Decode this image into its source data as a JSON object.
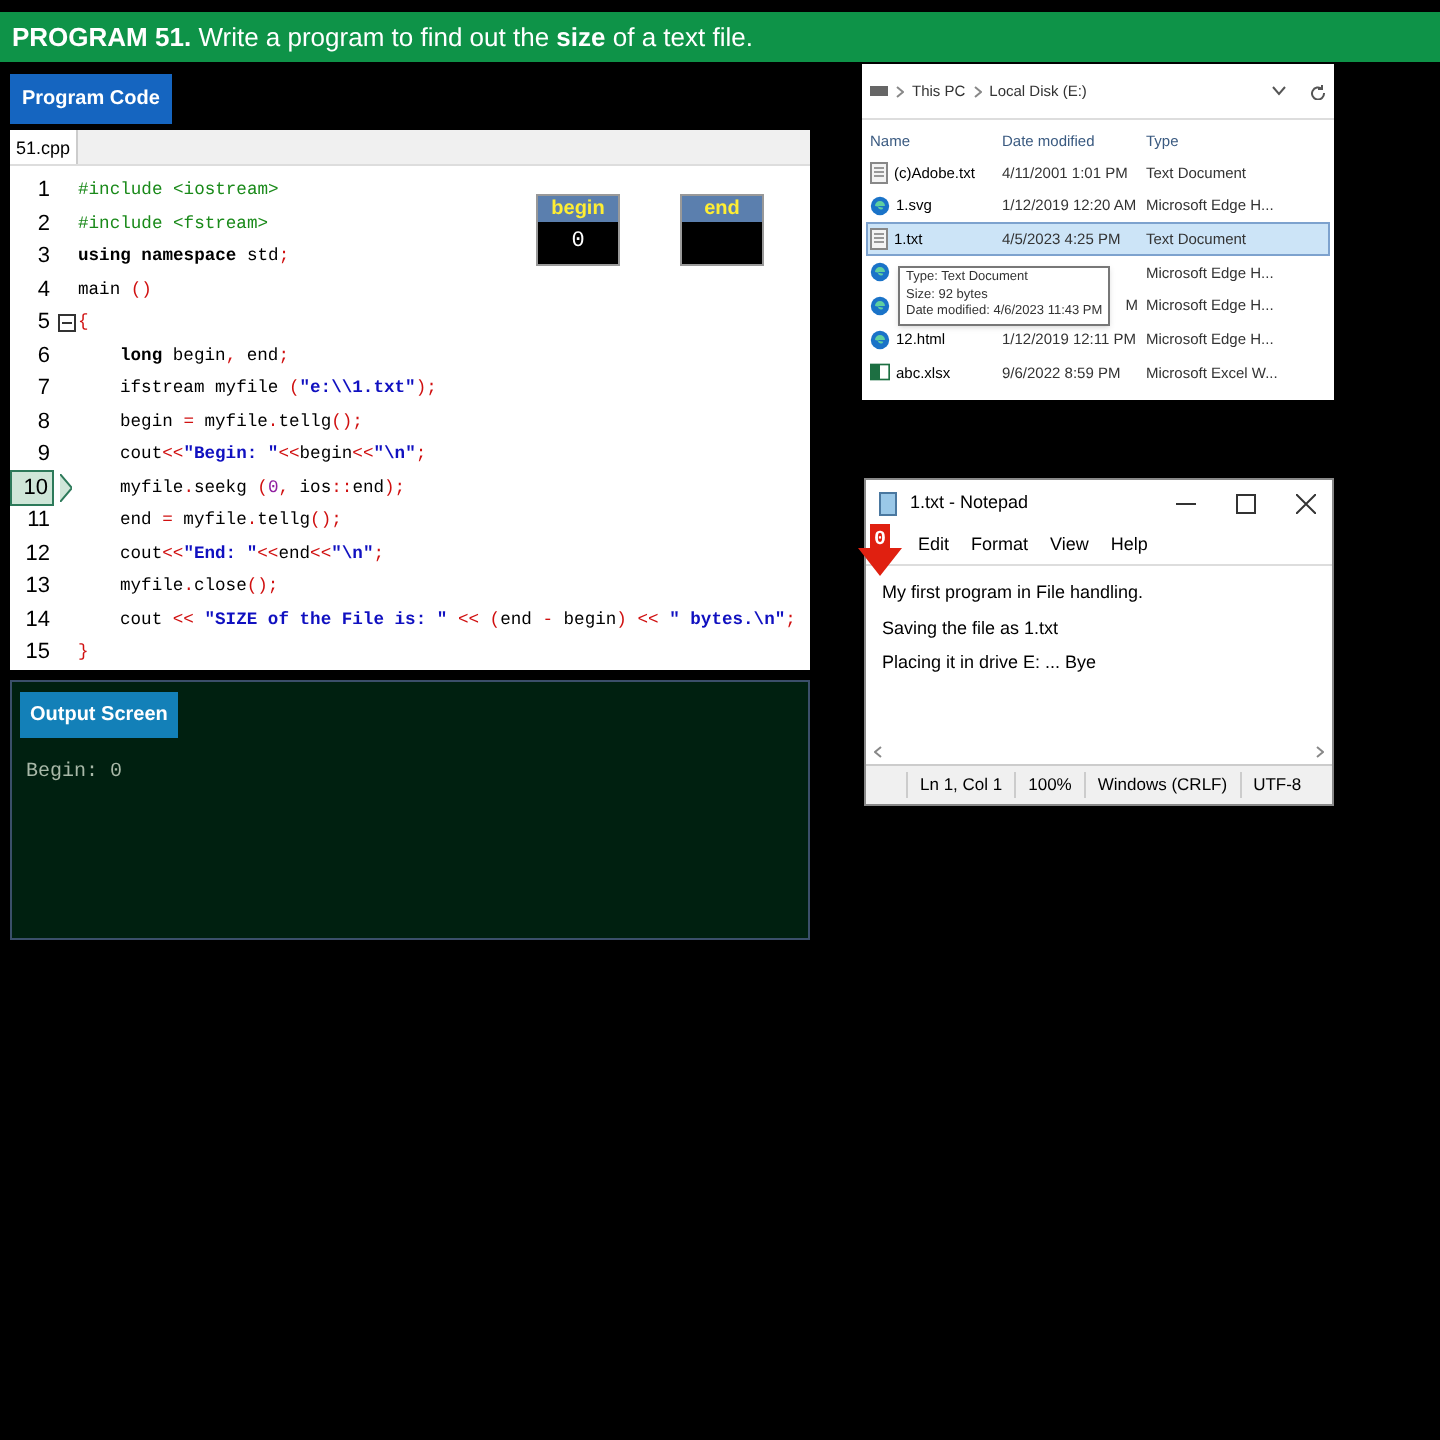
{
  "header": {
    "title_bold": "PROGRAM 51.",
    "title_rest": "Write a program to find out the **size** of a text file."
  },
  "code_label": "Program Code",
  "editor": {
    "tab": "51.cpp",
    "lines": [
      {
        "no": "1",
        "indent": false,
        "current": false,
        "foldable": false,
        "tokens": [
          {
            "kind": "pre",
            "text": "#include <iostream>"
          }
        ]
      },
      {
        "no": "2",
        "indent": false,
        "current": false,
        "foldable": false,
        "tokens": [
          {
            "kind": "pre",
            "text": "#include <fstream>"
          }
        ]
      },
      {
        "no": "3",
        "indent": false,
        "current": false,
        "foldable": false,
        "tokens": [
          {
            "kind": "kw",
            "text": "using namespace"
          },
          {
            "kind": "plain",
            "text": " std"
          },
          {
            "kind": "punct",
            "text": ";"
          }
        ]
      },
      {
        "no": "4",
        "indent": false,
        "current": false,
        "foldable": false,
        "tokens": [
          {
            "kind": "plain",
            "text": "main "
          },
          {
            "kind": "punct",
            "text": "()"
          }
        ]
      },
      {
        "no": "5",
        "indent": false,
        "current": false,
        "foldable": true,
        "tokens": [
          {
            "kind": "punct",
            "text": "{"
          }
        ]
      },
      {
        "no": "6",
        "indent": true,
        "current": false,
        "foldable": false,
        "tokens": [
          {
            "kind": "kw",
            "text": "long"
          },
          {
            "kind": "plain",
            "text": " begin"
          },
          {
            "kind": "punct",
            "text": ","
          },
          {
            "kind": "plain",
            "text": " end"
          },
          {
            "kind": "punct",
            "text": ";"
          }
        ]
      },
      {
        "no": "7",
        "indent": true,
        "current": false,
        "foldable": false,
        "tokens": [
          {
            "kind": "plain",
            "text": "ifstream myfile "
          },
          {
            "kind": "punct",
            "text": "("
          },
          {
            "kind": "str",
            "text": "\"e:\\\\1.txt\""
          },
          {
            "kind": "punct",
            "text": ");"
          }
        ]
      },
      {
        "no": "8",
        "indent": true,
        "current": false,
        "foldable": false,
        "tokens": [
          {
            "kind": "plain",
            "text": "begin "
          },
          {
            "kind": "punct",
            "text": "="
          },
          {
            "kind": "plain",
            "text": " myfile"
          },
          {
            "kind": "punct",
            "text": "."
          },
          {
            "kind": "plain",
            "text": "tellg"
          },
          {
            "kind": "punct",
            "text": "();"
          }
        ]
      },
      {
        "no": "9",
        "indent": true,
        "current": false,
        "foldable": false,
        "tokens": [
          {
            "kind": "plain",
            "text": "cout"
          },
          {
            "kind": "punct",
            "text": "<<"
          },
          {
            "kind": "str",
            "text": "\"Begin: \""
          },
          {
            "kind": "punct",
            "text": "<<"
          },
          {
            "kind": "plain",
            "text": "begin"
          },
          {
            "kind": "punct",
            "text": "<<"
          },
          {
            "kind": "str",
            "text": "\"\\n\""
          },
          {
            "kind": "punct",
            "text": ";"
          }
        ]
      },
      {
        "no": "10",
        "indent": true,
        "current": true,
        "foldable": false,
        "tokens": [
          {
            "kind": "plain",
            "text": "myfile"
          },
          {
            "kind": "punct",
            "text": "."
          },
          {
            "kind": "plain",
            "text": "seekg "
          },
          {
            "kind": "punct",
            "text": "("
          },
          {
            "kind": "num",
            "text": "0"
          },
          {
            "kind": "punct",
            "text": ","
          },
          {
            "kind": "plain",
            "text": " ios"
          },
          {
            "kind": "punct",
            "text": "::"
          },
          {
            "kind": "plain",
            "text": "end"
          },
          {
            "kind": "punct",
            "text": ");"
          }
        ]
      },
      {
        "no": "11",
        "indent": true,
        "current": false,
        "foldable": false,
        "tokens": [
          {
            "kind": "plain",
            "text": "end "
          },
          {
            "kind": "punct",
            "text": "="
          },
          {
            "kind": "plain",
            "text": " myfile"
          },
          {
            "kind": "punct",
            "text": "."
          },
          {
            "kind": "plain",
            "text": "tellg"
          },
          {
            "kind": "punct",
            "text": "();"
          }
        ]
      },
      {
        "no": "12",
        "indent": true,
        "current": false,
        "foldable": false,
        "tokens": [
          {
            "kind": "plain",
            "text": "cout"
          },
          {
            "kind": "punct",
            "text": "<<"
          },
          {
            "kind": "str",
            "text": "\"End: \""
          },
          {
            "kind": "punct",
            "text": "<<"
          },
          {
            "kind": "plain",
            "text": "end"
          },
          {
            "kind": "punct",
            "text": "<<"
          },
          {
            "kind": "str",
            "text": "\"\\n\""
          },
          {
            "kind": "punct",
            "text": ";"
          }
        ]
      },
      {
        "no": "13",
        "indent": true,
        "current": false,
        "foldable": false,
        "tokens": [
          {
            "kind": "plain",
            "text": "myfile"
          },
          {
            "kind": "punct",
            "text": "."
          },
          {
            "kind": "plain",
            "text": "close"
          },
          {
            "kind": "punct",
            "text": "();"
          }
        ]
      },
      {
        "no": "14",
        "indent": true,
        "current": false,
        "foldable": false,
        "tokens": [
          {
            "kind": "plain",
            "text": "cout "
          },
          {
            "kind": "punct",
            "text": "<<"
          },
          {
            "kind": "str",
            "text": " \"SIZE of the File is: \" "
          },
          {
            "kind": "punct",
            "text": "<< ("
          },
          {
            "kind": "plain",
            "text": "end "
          },
          {
            "kind": "punct",
            "text": "-"
          },
          {
            "kind": "plain",
            "text": " begin"
          },
          {
            "kind": "punct",
            "text": ") <<"
          },
          {
            "kind": "str",
            "text": " \" bytes.\\n\""
          },
          {
            "kind": "punct",
            "text": ";"
          }
        ]
      },
      {
        "no": "15",
        "indent": false,
        "current": false,
        "foldable": false,
        "tokens": [
          {
            "kind": "punct",
            "text": "}"
          }
        ]
      }
    ],
    "variables": [
      {
        "name": "begin",
        "value": "0"
      },
      {
        "name": "end"
      }
    ]
  },
  "output": {
    "label": "Output Screen",
    "lines": [
      "Begin: 0"
    ]
  },
  "explorer": {
    "path": [
      "This PC",
      "Local Disk (E:)"
    ],
    "columns": [
      "Name",
      "Date modified",
      "Type"
    ],
    "rows": [
      {
        "kind": "text",
        "name": "(c)Adobe.txt",
        "date": "4/11/2001 1:01 PM",
        "type": "Text Document",
        "selected": false
      },
      {
        "kind": "edge",
        "name": "1.svg",
        "date": "1/12/2019 12:20 AM",
        "type": "Microsoft Edge H...",
        "selected": false
      },
      {
        "kind": "text",
        "name": "1.txt",
        "date": "4/5/2023 4:25 PM",
        "type": "Text Document",
        "selected": true
      },
      {
        "kind": "edge",
        "type": "Microsoft Edge H...",
        "selected": false
      },
      {
        "kind": "edge",
        "date": "M",
        "type": "Microsoft Edge H...",
        "selected": false
      },
      {
        "kind": "edge",
        "name": "12.html",
        "date": "1/12/2019 12:11 PM",
        "type": "Microsoft Edge H...",
        "selected": false
      },
      {
        "kind": "excel",
        "name": "abc.xlsx",
        "date": "9/6/2022 8:59 PM",
        "type": "Microsoft Excel W...",
        "selected": false
      }
    ],
    "tooltip": [
      "Type: Text Document",
      "Size: 92 bytes",
      "Date modified: 4/6/2023 11:43 PM"
    ]
  },
  "notepad": {
    "title": "1.txt - Notepad",
    "menu": [
      "Edit",
      "Format",
      "View",
      "Help"
    ],
    "arrow_label": "0",
    "lines": [
      "My first program in File handling.",
      "Saving the file as 1.txt",
      "Placing it in drive E: ... Bye"
    ],
    "status": [
      "Ln 1, Col 1",
      "100%",
      "Windows (CRLF)",
      "UTF-8"
    ]
  }
}
